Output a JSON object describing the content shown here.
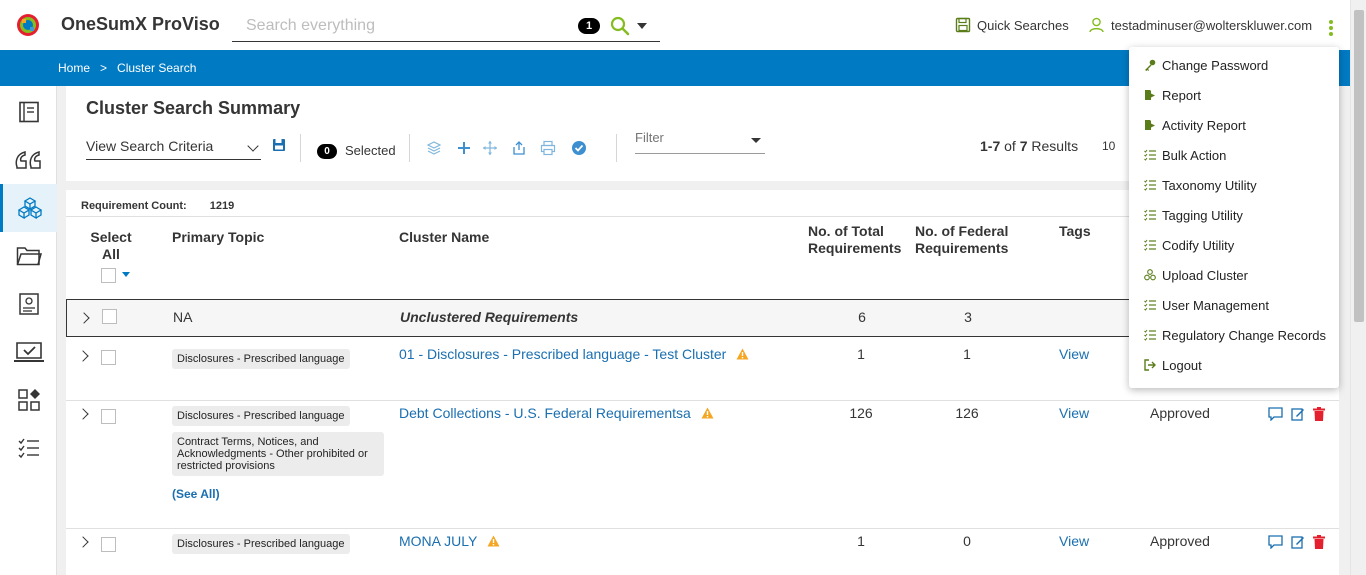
{
  "app": {
    "title": "OneSumX ProViso"
  },
  "search": {
    "placeholder": "Search everything",
    "count": "1"
  },
  "header": {
    "quick_searches": "Quick Searches",
    "user_email": "testadminuser@wolterskluwer.com"
  },
  "breadcrumb": {
    "home": "Home",
    "separator": ">",
    "current": "Cluster Search"
  },
  "sidebar": {
    "items": [
      "document-icon",
      "quote-icon",
      "cubes-icon",
      "folder-icon",
      "certificate-icon",
      "laptop-check-icon",
      "apps-icon",
      "checklist-icon"
    ],
    "active_index": 2
  },
  "toolbar": {
    "title": "Cluster Search Summary",
    "view_criteria": "View Search Criteria",
    "selected_count": "0",
    "selected_label": "Selected",
    "filter_placeholder": "Filter",
    "results_range": "1-7",
    "results_of": "of",
    "results_total": "7",
    "results_label": "Results",
    "per_page": "10"
  },
  "table": {
    "req_count_label": "Requirement Count:",
    "req_count_value": "1219",
    "headers": {
      "select_all": "Select All",
      "primary_topic": "Primary Topic",
      "cluster_name": "Cluster Name",
      "total_reqs": "No. of Total Requirements",
      "federal_reqs": "No. of Federal Requirements",
      "tags": "Tags"
    },
    "rows": [
      {
        "topic": "NA",
        "name": "Unclustered Requirements",
        "total": "6",
        "federal": "3"
      },
      {
        "topic": "Disclosures - Prescribed language",
        "name": "01 - Disclosures - Prescribed language - Test Cluster",
        "total": "1",
        "federal": "1",
        "tags": "View"
      },
      {
        "topic": "Disclosures - Prescribed language",
        "topic2": "Contract Terms, Notices, and Acknowledgments - Other prohibited or restricted provisions",
        "see_all": "(See All)",
        "name": "Debt Collections - U.S. Federal Requirementsa",
        "total": "126",
        "federal": "126",
        "tags": "View",
        "status": "Approved"
      },
      {
        "topic": "Disclosures - Prescribed language",
        "name": "MONA JULY",
        "total": "1",
        "federal": "0",
        "tags": "View",
        "status": "Approved"
      }
    ]
  },
  "menu": {
    "items": [
      {
        "label": "Change Password",
        "icon": "key-icon"
      },
      {
        "label": "Report",
        "icon": "report-icon"
      },
      {
        "label": "Activity Report",
        "icon": "activity-report-icon"
      },
      {
        "label": "Bulk Action",
        "icon": "list-check-icon"
      },
      {
        "label": "Taxonomy Utility",
        "icon": "list-check-icon"
      },
      {
        "label": "Tagging Utility",
        "icon": "list-check-icon"
      },
      {
        "label": "Codify Utility",
        "icon": "list-check-icon"
      },
      {
        "label": "Upload Cluster",
        "icon": "cubes-icon"
      },
      {
        "label": "User Management",
        "icon": "list-check-icon"
      },
      {
        "label": "Regulatory Change Records",
        "icon": "list-check-icon"
      },
      {
        "label": "Logout",
        "icon": "logout-icon"
      }
    ]
  },
  "colors": {
    "brand_blue": "#007ac3",
    "accent_green": "#85bc20",
    "warning": "#f5a623",
    "delete_red": "#e5202e"
  }
}
